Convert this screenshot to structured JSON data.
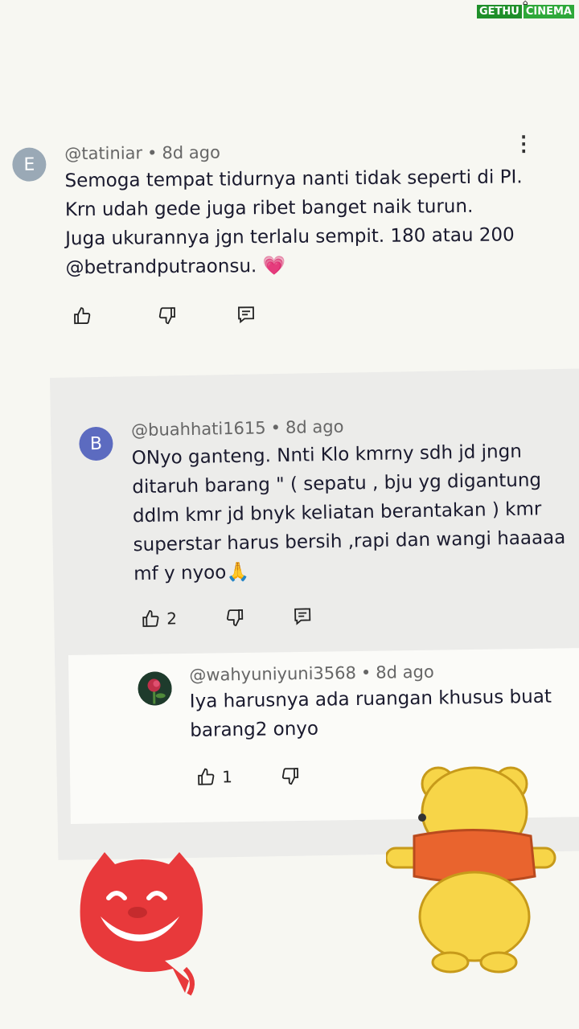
{
  "watermark": {
    "part1": "GETHU",
    "part2": "CINEMA"
  },
  "comments": [
    {
      "avatar_letter": "E",
      "avatar_color": "#9aa9b6",
      "username": "@tatiniar",
      "time": "8d ago",
      "text": "Semoga tempat tidurnya nanti tidak seperti di PI.\nKrn udah gede juga ribet banget naik turun.\nJuga ukurannya jgn terlalu sempit. 180 atau 200\n@betrandputraonsu. 💗",
      "likes": ""
    },
    {
      "avatar_letter": "B",
      "avatar_color": "#5c6bc0",
      "username": "@buahhati1615",
      "time": "8d ago",
      "text": "ONyo ganteng.  Nnti Klo kmrny  sdh jd jngn\nditaruh barang \" (  sepatu , bju yg digantung\nddlm kmr jd  bnyk keliatan berantakan ) kmr\nsuperstar harus bersih ,rapi dan  wangi haaaaa\nmf y nyoo🙏",
      "likes": "2"
    }
  ],
  "reply": {
    "username": "@wahyuniyuni3568",
    "time": "8d ago",
    "text": "Iya harusnya ada ruangan khusus buat\nbarang2 onyo",
    "likes": "1"
  },
  "stickers": {
    "left": "red-devil-sticker",
    "right": "winnie-the-pooh-sticker"
  }
}
